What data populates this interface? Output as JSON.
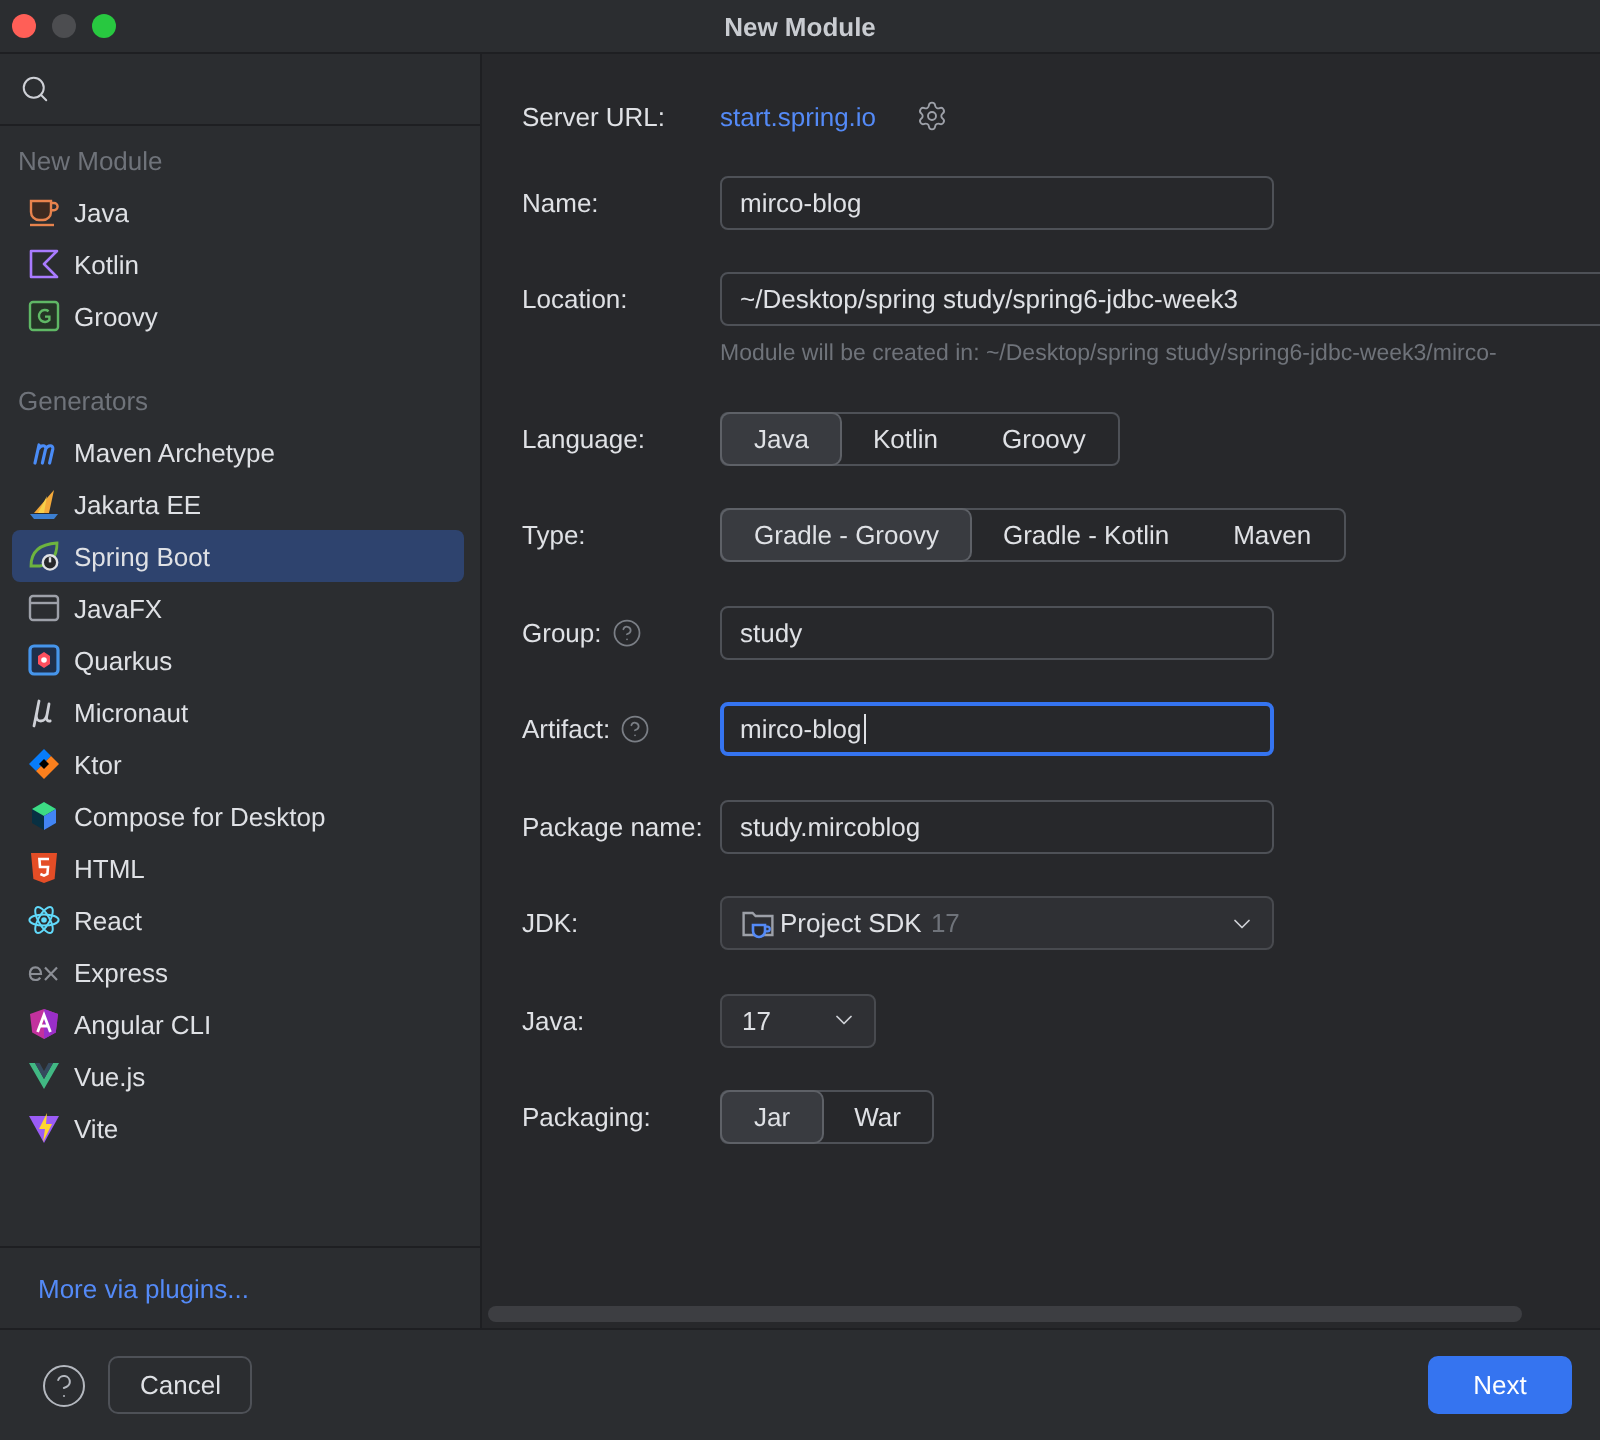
{
  "window": {
    "title": "New Module",
    "minimize_disabled": true
  },
  "sidebar": {
    "sections": [
      {
        "header": "New Module",
        "items": [
          {
            "label": "Java",
            "selected": false
          },
          {
            "label": "Kotlin",
            "selected": false
          },
          {
            "label": "Groovy",
            "selected": false
          }
        ]
      },
      {
        "header": "Generators",
        "items": [
          {
            "label": "Maven Archetype",
            "selected": false
          },
          {
            "label": "Jakarta EE",
            "selected": false
          },
          {
            "label": "Spring Boot",
            "selected": true
          },
          {
            "label": "JavaFX",
            "selected": false
          },
          {
            "label": "Quarkus",
            "selected": false
          },
          {
            "label": "Micronaut",
            "selected": false
          },
          {
            "label": "Ktor",
            "selected": false
          },
          {
            "label": "Compose for Desktop",
            "selected": false
          },
          {
            "label": "HTML",
            "selected": false
          },
          {
            "label": "React",
            "selected": false
          },
          {
            "label": "Express",
            "selected": false
          },
          {
            "label": "Angular CLI",
            "selected": false
          },
          {
            "label": "Vue.js",
            "selected": false
          },
          {
            "label": "Vite",
            "selected": false
          }
        ]
      }
    ],
    "more_link": "More via plugins..."
  },
  "form": {
    "rows": [
      {
        "kind": "link",
        "label": "Server URL:",
        "value": "start.spring.io"
      },
      {
        "kind": "text",
        "label": "Name:",
        "value": "mirco-blog",
        "help": false,
        "focused": false
      },
      {
        "kind": "path",
        "label": "Location:",
        "value": "~/Desktop/spring study/spring6-jdbc-week3",
        "hint": "Module will be created in: ~/Desktop/spring study/spring6-jdbc-week3/mirco-"
      },
      {
        "kind": "segmented",
        "label": "Language:",
        "options": [
          {
            "label": "Java",
            "selected": true
          },
          {
            "label": "Kotlin",
            "selected": false
          },
          {
            "label": "Groovy",
            "selected": false
          }
        ]
      },
      {
        "kind": "segmented",
        "label": "Type:",
        "options": [
          {
            "label": "Gradle - Groovy",
            "selected": true
          },
          {
            "label": "Gradle - Kotlin",
            "selected": false
          },
          {
            "label": "Maven",
            "selected": false
          }
        ]
      },
      {
        "kind": "text",
        "label": "Group:",
        "value": "study",
        "help": true,
        "focused": false
      },
      {
        "kind": "text",
        "label": "Artifact:",
        "value": "mirco-blog",
        "help": true,
        "focused": true
      },
      {
        "kind": "text",
        "label": "Package name:",
        "value": "study.mircoblog",
        "help": false,
        "focused": false
      },
      {
        "kind": "sdk",
        "label": "JDK:",
        "value": "Project SDK",
        "version": "17"
      },
      {
        "kind": "select",
        "label": "Java:",
        "value": "17"
      },
      {
        "kind": "segmented",
        "label": "Packaging:",
        "options": [
          {
            "label": "Jar",
            "selected": true
          },
          {
            "label": "War",
            "selected": false
          }
        ]
      }
    ]
  },
  "footer": {
    "buttons": [
      {
        "kind": "secondary",
        "label": "Cancel"
      },
      {
        "kind": "primary",
        "label": "Next"
      }
    ]
  }
}
